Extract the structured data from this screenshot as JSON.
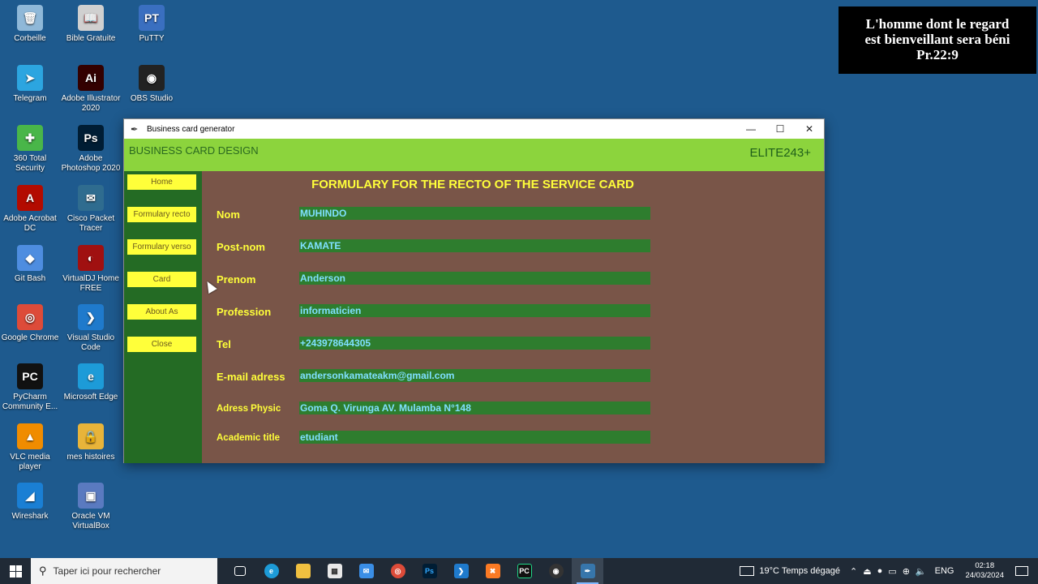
{
  "desktop": {
    "icons": [
      {
        "label": "Corbeille",
        "icon": "recycle-bin-icon",
        "color": "#8fb8d8",
        "glyph": "🗑"
      },
      {
        "label": "Bible Gratuite",
        "icon": "book-icon",
        "color": "#d0d0d0",
        "glyph": "📖"
      },
      {
        "label": "PuTTY",
        "icon": "putty-icon",
        "color": "#3a6fc0",
        "glyph": "PT"
      },
      {
        "label": "Telegram",
        "icon": "telegram-icon",
        "color": "#2ca5e0",
        "glyph": "➤"
      },
      {
        "label": "Adobe Illustrator 2020",
        "icon": "illustrator-icon",
        "color": "#330000",
        "glyph": "Ai"
      },
      {
        "label": "OBS Studio",
        "icon": "obs-icon",
        "color": "#222222",
        "glyph": "◉"
      },
      {
        "label": "360 Total Security",
        "icon": "security-icon",
        "color": "#49b649",
        "glyph": "✚"
      },
      {
        "label": "Adobe Photoshop 2020",
        "icon": "photoshop-icon",
        "color": "#001d34",
        "glyph": "Ps"
      },
      {
        "label": "Adobe Acrobat DC",
        "icon": "acrobat-icon",
        "color": "#b30b00",
        "glyph": "A"
      },
      {
        "label": "Cisco Packet Tracer",
        "icon": "packet-tracer-icon",
        "color": "#2f6c8f",
        "glyph": "✉"
      },
      {
        "label": "Git Bash",
        "icon": "git-bash-icon",
        "color": "#4e8de0",
        "glyph": "◆"
      },
      {
        "label": "VirtualDJ Home FREE",
        "icon": "virtualdj-icon",
        "color": "#a01010",
        "glyph": "◐"
      },
      {
        "label": "Google Chrome",
        "icon": "chrome-icon",
        "color": "#dd4b39",
        "glyph": "◎"
      },
      {
        "label": "Visual Studio Code",
        "icon": "vscode-icon",
        "color": "#1f7acc",
        "glyph": "❯"
      },
      {
        "label": "PyCharm Community E...",
        "icon": "pycharm-icon",
        "color": "#111111",
        "glyph": "PC"
      },
      {
        "label": "Microsoft Edge",
        "icon": "edge-icon",
        "color": "#1d9bd8",
        "glyph": "e"
      },
      {
        "label": "VLC media player",
        "icon": "vlc-icon",
        "color": "#f08c00",
        "glyph": "▲"
      },
      {
        "label": "mes histoires",
        "icon": "lock-icon",
        "color": "#e8b43a",
        "glyph": "🔒"
      },
      {
        "label": "Wireshark",
        "icon": "wireshark-icon",
        "color": "#1a7fd4",
        "glyph": "◢"
      },
      {
        "label": "Oracle VM VirtualBox",
        "icon": "virtualbox-icon",
        "color": "#5a7ac0",
        "glyph": "▣"
      }
    ]
  },
  "quote": {
    "line1": "L'homme dont le regard",
    "line2": "est bienveillant sera béni",
    "line3": "Pr.22:9"
  },
  "window": {
    "title": "Business card generator",
    "header_left": "BUSINESS CARD DESIGN",
    "header_right": "ELITE243+",
    "minimize": "—",
    "maximize": "☐",
    "close": "✕"
  },
  "nav": {
    "home": "Home",
    "recto": "Formulary recto",
    "verso": "Formulary verso",
    "card": "Card",
    "about": "About As",
    "close": "Close"
  },
  "form": {
    "title": "FORMULARY FOR THE RECTO OF THE SERVICE CARD",
    "fields": [
      {
        "label": "Nom",
        "value": "MUHINDO"
      },
      {
        "label": "Post-nom",
        "value": "KAMATE"
      },
      {
        "label": "Prenom",
        "value": "Anderson"
      },
      {
        "label": "Profession",
        "value": "informaticien"
      },
      {
        "label": "Tel",
        "value": "+243978644305"
      },
      {
        "label": "E-mail adress",
        "value": "andersonkamateakm@gmail.com"
      },
      {
        "label": "Adress Physic",
        "value": "Goma Q. Virunga AV. Mulamba N°148"
      },
      {
        "label": "Academic title",
        "value": "etudiant"
      }
    ]
  },
  "taskbar": {
    "search_placeholder": "Taper ici pour rechercher",
    "weather": "19°C  Temps dégagé",
    "lang": "ENG",
    "time": "02:18",
    "date": "24/03/2024"
  },
  "colors": {
    "desktop_bg": "#1e5a8e",
    "header_green": "#8cd43d",
    "sidebar_green": "#246b24",
    "content_brown": "#795548",
    "accent_yellow": "#ffff3a",
    "input_green": "#2e7d2e",
    "input_text": "#7fe0ff"
  }
}
